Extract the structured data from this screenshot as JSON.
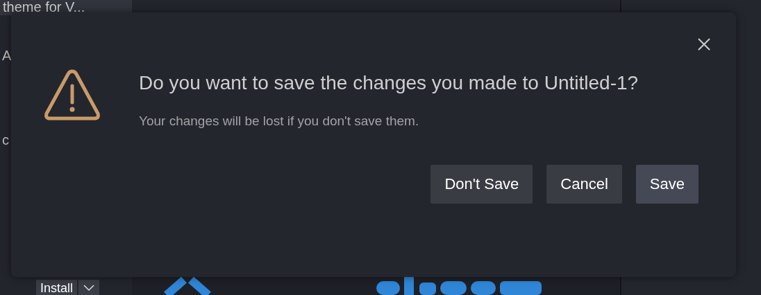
{
  "sidebar": {
    "items": [
      {
        "label": "theme for V...",
        "kind": "title"
      },
      {
        "label": "A",
        "kind": "fragment"
      },
      {
        "label": "c",
        "kind": "fragment"
      }
    ],
    "install_button": {
      "label": "Install"
    }
  },
  "dialog": {
    "title": "Do you want to save the changes you made to Untitled-1?",
    "message": "Your changes will be lost if you don't save them.",
    "buttons": [
      {
        "label": "Don't Save",
        "kind": "secondary"
      },
      {
        "label": "Cancel",
        "kind": "secondary"
      },
      {
        "label": "Save",
        "kind": "primary"
      }
    ]
  }
}
